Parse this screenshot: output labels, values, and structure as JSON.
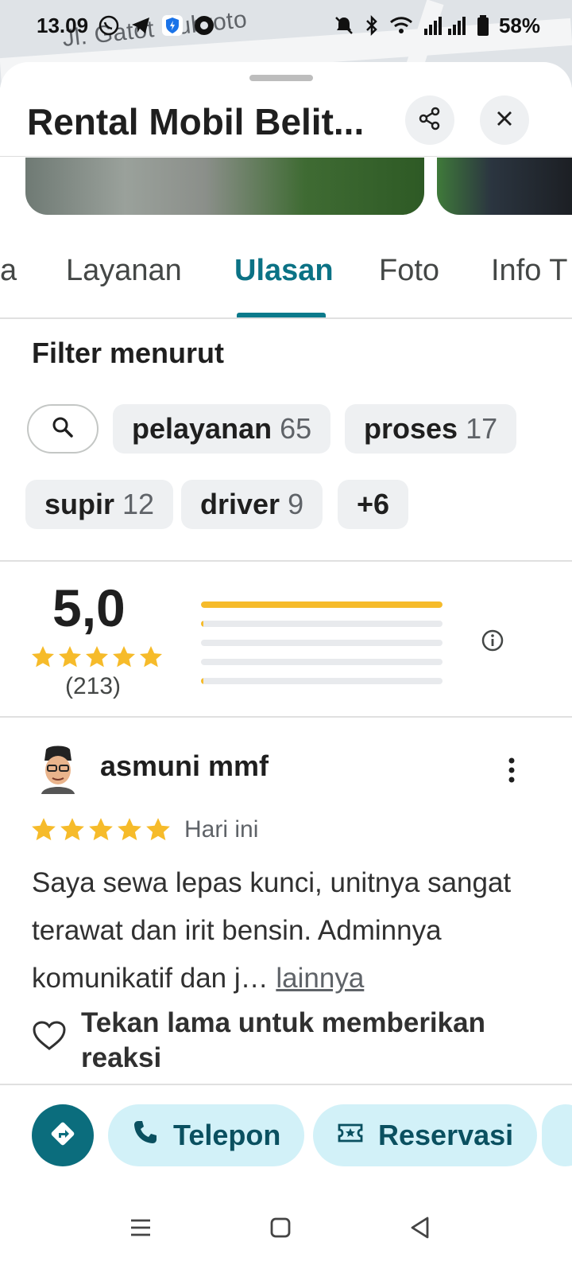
{
  "status_bar": {
    "time": "13.09",
    "battery": "58%"
  },
  "map": {
    "street_label": "Jl. Gatot Subroto"
  },
  "place": {
    "title": "Rental Mobil Belit..."
  },
  "tabs": [
    {
      "label": "a"
    },
    {
      "label": "Layanan"
    },
    {
      "label": "Ulasan",
      "active": true
    },
    {
      "label": "Foto"
    },
    {
      "label": "Info T"
    }
  ],
  "filter": {
    "title": "Filter menurut",
    "chips": [
      {
        "label": "pelayanan",
        "count": "65"
      },
      {
        "label": "proses",
        "count": "17"
      },
      {
        "label": "supir",
        "count": "12"
      },
      {
        "label": "driver",
        "count": "9"
      },
      {
        "label": "+6",
        "count": ""
      }
    ]
  },
  "rating_summary": {
    "score": "5,0",
    "stars": 5,
    "count_label": "(213)",
    "distribution": [
      {
        "stars": 5,
        "fraction": 1.0
      },
      {
        "stars": 4,
        "fraction": 0.01
      },
      {
        "stars": 3,
        "fraction": 0.0
      },
      {
        "stars": 2,
        "fraction": 0.0
      },
      {
        "stars": 1,
        "fraction": 0.01
      }
    ]
  },
  "review": {
    "author": "asmuni mmf",
    "stars": 5,
    "date": "Hari ini",
    "text": "Saya sewa lepas kunci, unitnya sangat terawat dan irit bensin. Adminnya komunikatif dan j…",
    "more_label": "lainnya",
    "reaction_hint": "Tekan lama untuk memberikan reaksi"
  },
  "actions": {
    "call_label": "Telepon",
    "reserve_label": "Reservasi"
  },
  "colors": {
    "accent": "#0b7a8b",
    "star": "#f6bb2a",
    "pill_bg": "#d2f1f8"
  }
}
